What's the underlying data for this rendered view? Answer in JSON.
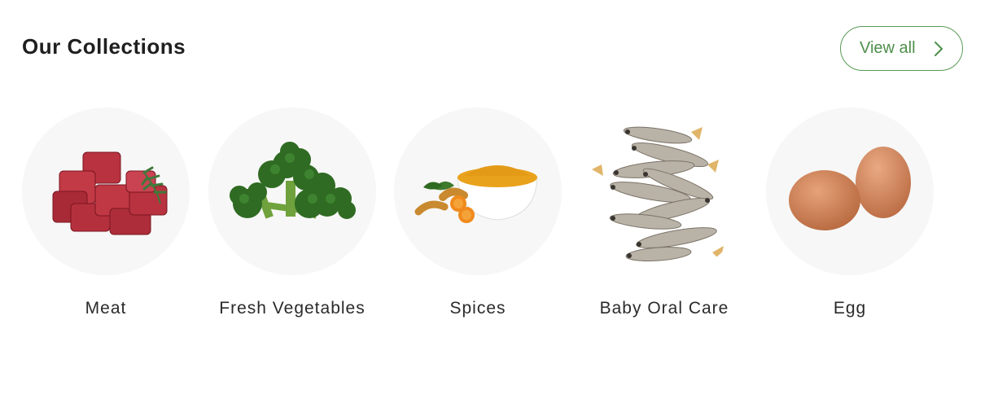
{
  "header": {
    "title": "Our Collections",
    "view_all_label": "View all"
  },
  "colors": {
    "accent": "#4e8f4b",
    "circle_bg": "#f7f7f7"
  },
  "collections": [
    {
      "label": "Meat",
      "image": "meat-cubes-image"
    },
    {
      "label": "Fresh Vegetables",
      "image": "broccoli-image"
    },
    {
      "label": "Spices",
      "image": "turmeric-bowl-image"
    },
    {
      "label": "Baby Oral Care",
      "image": "dried-fish-image"
    },
    {
      "label": "Egg",
      "image": "eggs-image"
    }
  ]
}
